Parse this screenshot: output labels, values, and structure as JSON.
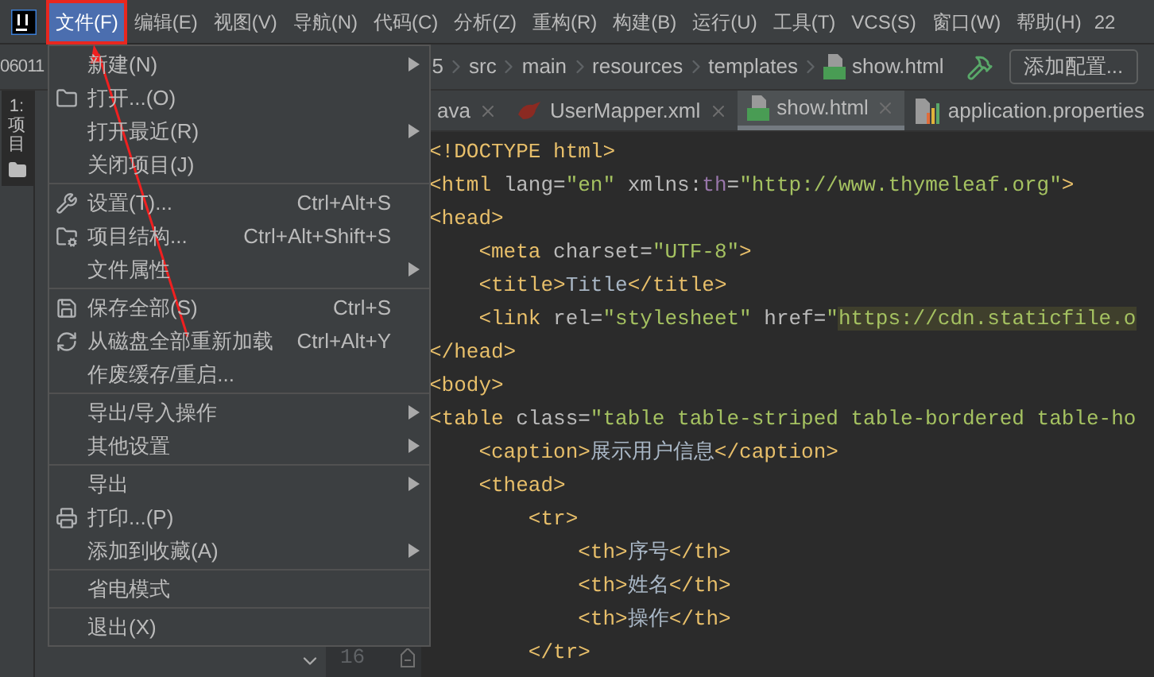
{
  "menubar": {
    "items": [
      {
        "label": "文件(F)",
        "selected": true,
        "marked": true
      },
      {
        "label": "编辑(E)",
        "selected": false,
        "marked": false
      },
      {
        "label": "视图(V)",
        "selected": false,
        "marked": false
      },
      {
        "label": "导航(N)",
        "selected": false,
        "marked": false
      },
      {
        "label": "代码(C)",
        "selected": false,
        "marked": false
      },
      {
        "label": "分析(Z)",
        "selected": false,
        "marked": false
      },
      {
        "label": "重构(R)",
        "selected": false,
        "marked": false
      },
      {
        "label": "构建(B)",
        "selected": false,
        "marked": false
      },
      {
        "label": "运行(U)",
        "selected": false,
        "marked": false
      },
      {
        "label": "工具(T)",
        "selected": false,
        "marked": false
      },
      {
        "label": "VCS(S)",
        "selected": false,
        "marked": false
      },
      {
        "label": "窗口(W)",
        "selected": false,
        "marked": false
      },
      {
        "label": "帮助(H)",
        "selected": false,
        "marked": false
      }
    ],
    "trailing": "22"
  },
  "navbar": {
    "project_fragment": "06011",
    "breadcrumbs": [
      "5",
      "src",
      "main",
      "resources",
      "templates",
      "show.html"
    ],
    "config_button": "添加配置..."
  },
  "tool_stripe": {
    "label": "1: 项目",
    "selected": true
  },
  "file_menu": [
    {
      "kind": "item",
      "label": "新建(N)",
      "submenu": true
    },
    {
      "kind": "item",
      "label": "打开...(O)",
      "submenu": false
    },
    {
      "kind": "item",
      "label": "打开最近(R)",
      "submenu": true
    },
    {
      "kind": "item",
      "label": "关闭项目(J)",
      "submenu": false
    },
    {
      "kind": "separator"
    },
    {
      "kind": "item",
      "label": "设置(T)...",
      "shortcut": "Ctrl+Alt+S",
      "submenu": false
    },
    {
      "kind": "item",
      "label": "项目结构...",
      "shortcut": "Ctrl+Alt+Shift+S",
      "submenu": false
    },
    {
      "kind": "item",
      "label": "文件属性",
      "submenu": true
    },
    {
      "kind": "separator"
    },
    {
      "kind": "item",
      "label": "保存全部(S)",
      "shortcut": "Ctrl+S",
      "submenu": false
    },
    {
      "kind": "item",
      "label": "从磁盘全部重新加载",
      "shortcut": "Ctrl+Alt+Y",
      "submenu": false
    },
    {
      "kind": "item",
      "label": "作废缓存/重启...",
      "submenu": false
    },
    {
      "kind": "separator"
    },
    {
      "kind": "item",
      "label": "导出/导入操作",
      "submenu": true
    },
    {
      "kind": "item",
      "label": "其他设置",
      "submenu": true
    },
    {
      "kind": "separator"
    },
    {
      "kind": "item",
      "label": "导出",
      "submenu": true
    },
    {
      "kind": "item",
      "label": "打印...(P)",
      "submenu": false
    },
    {
      "kind": "item",
      "label": "添加到收藏(A)",
      "submenu": true
    },
    {
      "kind": "separator"
    },
    {
      "kind": "item",
      "label": "省电模式",
      "submenu": false
    },
    {
      "kind": "separator"
    },
    {
      "kind": "item",
      "label": "退出(X)",
      "submenu": false
    }
  ],
  "annotation_arrow": true,
  "tabs": [
    {
      "label": "ava",
      "selected": false
    },
    {
      "label": "UserMapper.xml",
      "selected": false
    },
    {
      "label": "show.html",
      "selected": true
    },
    {
      "label": "application.properties",
      "selected": false
    }
  ],
  "editor": {
    "visible_line_number": "16",
    "lines": [
      [
        {
          "kind": "tag",
          "text": "<!DOCTYPE html>"
        }
      ],
      [
        {
          "kind": "tag",
          "text": "<html"
        },
        {
          "kind": "attr",
          "text": " lang="
        },
        {
          "kind": "value",
          "text": "\"en\""
        },
        {
          "kind": "attr",
          "text": " xmlns:"
        },
        {
          "kind": "ns",
          "text": "th"
        },
        {
          "kind": "attr",
          "text": "="
        },
        {
          "kind": "value",
          "text": "\"http://www.thymeleaf.org\""
        },
        {
          "kind": "tag",
          "text": ">"
        }
      ],
      [
        {
          "kind": "tag",
          "text": "<head>"
        }
      ],
      [
        {
          "kind": "tag",
          "text": "    <meta"
        },
        {
          "kind": "attr",
          "text": " charset="
        },
        {
          "kind": "value",
          "text": "\"UTF-8\""
        },
        {
          "kind": "tag",
          "text": ">"
        }
      ],
      [
        {
          "kind": "tag",
          "text": "    <title>"
        },
        {
          "kind": "text",
          "text": "Title"
        },
        {
          "kind": "tag",
          "text": "</title>"
        }
      ],
      [
        {
          "kind": "tag",
          "text": "    <link"
        },
        {
          "kind": "attr",
          "text": " rel="
        },
        {
          "kind": "value",
          "text": "\"stylesheet\""
        },
        {
          "kind": "attr",
          "text": " href="
        },
        {
          "kind": "value",
          "text": "\""
        },
        {
          "kind": "url",
          "text": "https://cdn.staticfile.o"
        }
      ],
      [
        {
          "kind": "tag",
          "text": "</head>"
        }
      ],
      [
        {
          "kind": "tag",
          "text": "<body>"
        }
      ],
      [
        {
          "kind": "tag",
          "text": "<table"
        },
        {
          "kind": "attr",
          "text": " class="
        },
        {
          "kind": "value",
          "text": "\"table table-striped table-bordered table-ho"
        }
      ],
      [
        {
          "kind": "tag",
          "text": "    <caption>"
        },
        {
          "kind": "text",
          "text": "展示用户信息"
        },
        {
          "kind": "tag",
          "text": "</caption>"
        }
      ],
      [
        {
          "kind": "tag",
          "text": "    <thead>"
        }
      ],
      [
        {
          "kind": "tag",
          "text": "        <tr>"
        }
      ],
      [
        {
          "kind": "tag",
          "text": "            <th>"
        },
        {
          "kind": "text",
          "text": "序号"
        },
        {
          "kind": "tag",
          "text": "</th>"
        }
      ],
      [
        {
          "kind": "tag",
          "text": "            <th>"
        },
        {
          "kind": "text",
          "text": "姓名"
        },
        {
          "kind": "tag",
          "text": "</th>"
        }
      ],
      [
        {
          "kind": "tag",
          "text": "            <th>"
        },
        {
          "kind": "text",
          "text": "操作"
        },
        {
          "kind": "tag",
          "text": "</th>"
        }
      ],
      [
        {
          "kind": "tag",
          "text": "        </tr>"
        }
      ]
    ]
  }
}
